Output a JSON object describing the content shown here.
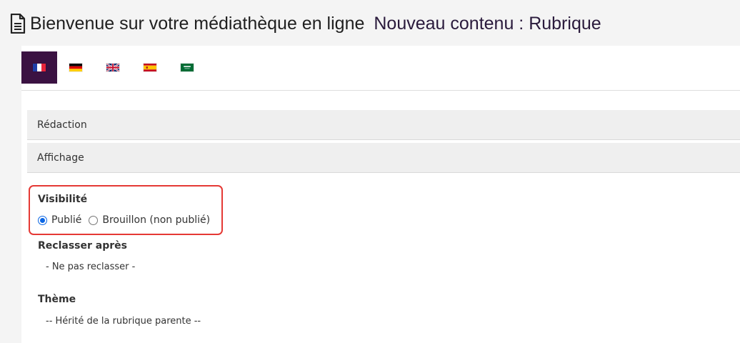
{
  "header": {
    "title_main": "Bienvenue sur votre médiathèque en ligne",
    "title_accent": "Nouveau contenu : Rubrique",
    "icon": "document-icon"
  },
  "languages": [
    {
      "code": "fr",
      "icon": "flag-france-icon",
      "active": true
    },
    {
      "code": "de",
      "icon": "flag-germany-icon",
      "active": false
    },
    {
      "code": "en",
      "icon": "flag-uk-icon",
      "active": false
    },
    {
      "code": "es",
      "icon": "flag-spain-icon",
      "active": false
    },
    {
      "code": "ar",
      "icon": "flag-saudi-icon",
      "active": false
    }
  ],
  "sections": {
    "redaction": "Rédaction",
    "affichage": "Affichage"
  },
  "form": {
    "visibility": {
      "label": "Visibilité",
      "options": [
        "Publié",
        "Brouillon (non publié)"
      ],
      "selected": "Publié"
    },
    "reclasser": {
      "label": "Reclasser après",
      "value": "- Ne pas reclasser -"
    },
    "theme": {
      "label": "Thème",
      "value": "-- Hérité de la rubrique parente --"
    }
  },
  "colors": {
    "active_tab": "#3b1242",
    "highlight": "#e53935",
    "radio_checked": "#0b66e4"
  }
}
